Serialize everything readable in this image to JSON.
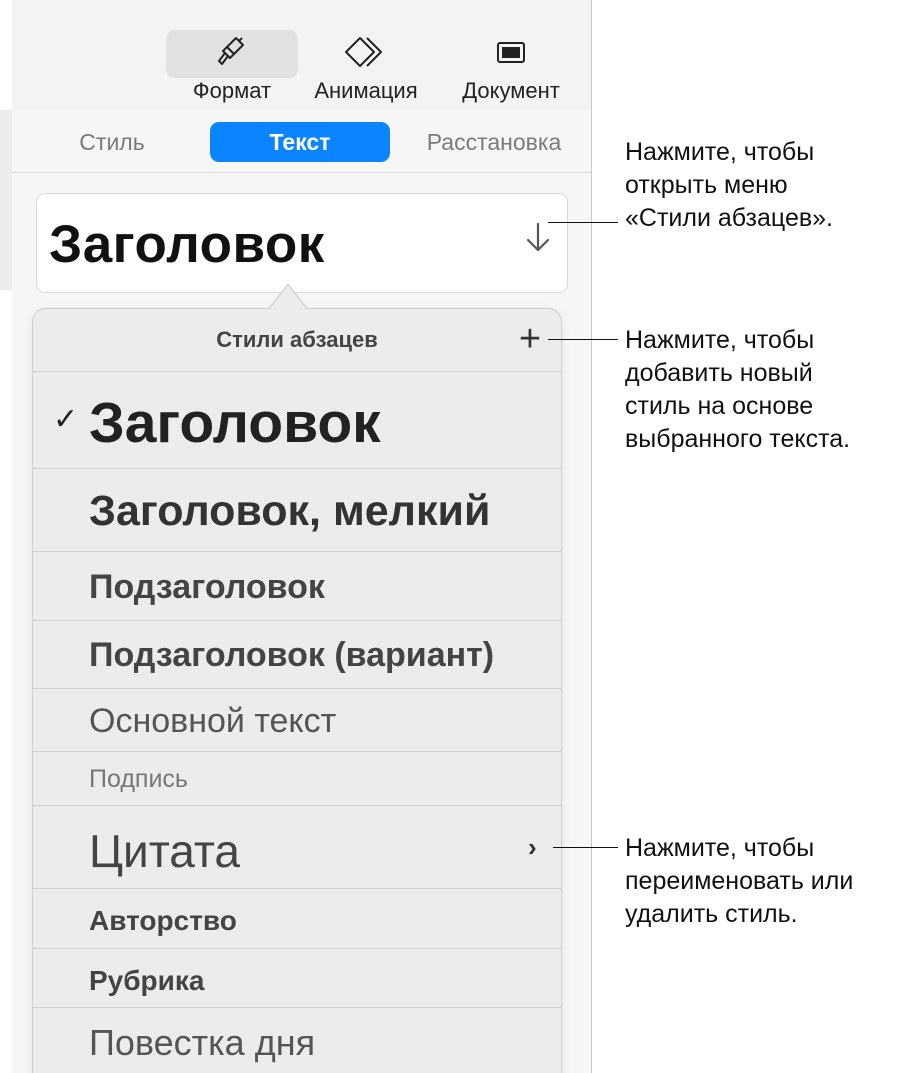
{
  "toolbar": {
    "format_label": "Формат",
    "animation_label": "Анимация",
    "document_label": "Документ"
  },
  "tabs": [
    {
      "label": "Стиль"
    },
    {
      "label": "Текст"
    },
    {
      "label": "Расстановка"
    }
  ],
  "paragraph_style": {
    "current_value": "Заголовок"
  },
  "popover": {
    "title": "Стили абзацев",
    "add_symbol": "+",
    "checkmark": "✓",
    "chevron": "›",
    "styles": [
      {
        "label": "Заголовок"
      },
      {
        "label": "Заголовок, мелкий"
      },
      {
        "label": "Подзаголовок"
      },
      {
        "label": "Подзаголовок (вариант)"
      },
      {
        "label": "Основной текст"
      },
      {
        "label": "Подпись"
      },
      {
        "label": "Цитата"
      },
      {
        "label": "Авторство"
      },
      {
        "label": "Рубрика"
      },
      {
        "label": "Повестка дня"
      }
    ]
  },
  "callouts": {
    "menu": [
      "Нажмите, чтобы",
      "открыть меню",
      "«Стили абзацев»."
    ],
    "add": [
      "Нажмите, чтобы",
      "добавить новый",
      "стиль на основе",
      "выбранного текста."
    ],
    "rename": [
      "Нажмите, чтобы",
      "переименовать или",
      "удалить стиль."
    ]
  },
  "colors": {
    "accent": "#0a84ff",
    "panel_bg": "#f6f6f6",
    "popover_bg": "#ececec"
  }
}
